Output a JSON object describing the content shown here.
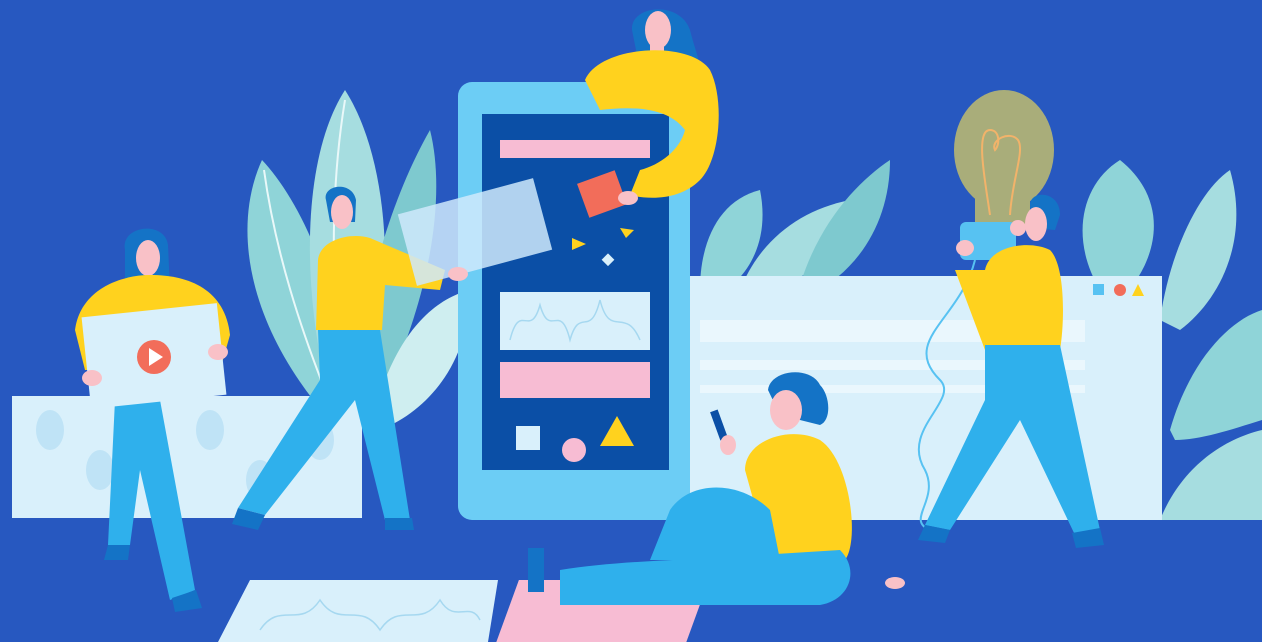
{
  "illustration": {
    "subject": "",
    "colors": {
      "background": "#2758c0",
      "phone_frame": "#6ccdf5",
      "phone_screen": "#0b4fa6",
      "pink_block": "#f7bcd3",
      "pale_block": "#d9f0fb",
      "shirt_yellow": "#ffd21e",
      "pants_blue": "#2fb0ec",
      "skin": "#f9c1c7",
      "hair": "#1473c6",
      "leaf_teal": "#8fd4d8",
      "leaf_light": "#cfeef0",
      "play_button": "#f26d5a",
      "window_dot_blue": "#57c2f2",
      "window_dot_red": "#f26d5a",
      "window_dot_yellow": "#ffd21e",
      "bulb": "#a9ad7a"
    },
    "icons": [
      "play-icon",
      "lightbulb-icon",
      "smartphone-icon",
      "window-controls-icon"
    ]
  }
}
